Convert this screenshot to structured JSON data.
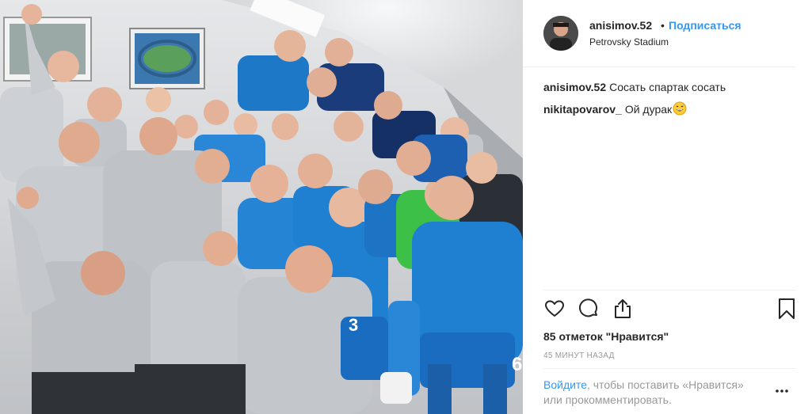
{
  "header": {
    "username": "anisimov.52",
    "separator": "•",
    "follow_label": "Подписаться",
    "location": "Petrovsky Stadium"
  },
  "comments": [
    {
      "username": "anisimov.52",
      "text": "Сосать спартак сосать"
    },
    {
      "username": "nikitapovarov_",
      "text": "Ой дурак"
    }
  ],
  "icons": {
    "like": "heart-icon",
    "comment": "comment-icon",
    "share": "share-icon",
    "save": "bookmark-icon",
    "more": "more-icon",
    "emoji": "grinning-sweat-emoji"
  },
  "likes_text": "85 отметок \"Нравится\"",
  "timestamp": "45 МИНУТ НАЗАД",
  "login_prompt": {
    "link": "Войдите",
    "text": ", чтобы поставить «Нравится» или прокомментировать."
  },
  "photo": {
    "shirt_numbers": [
      "3",
      "6"
    ]
  },
  "colors": {
    "link_blue": "#3897f0",
    "text": "#262626",
    "muted": "#999999",
    "kit_blue": "#1f7fd0",
    "tracksuit_grey": "#c9ccd0",
    "goalkeeper_green": "#3dc048"
  }
}
